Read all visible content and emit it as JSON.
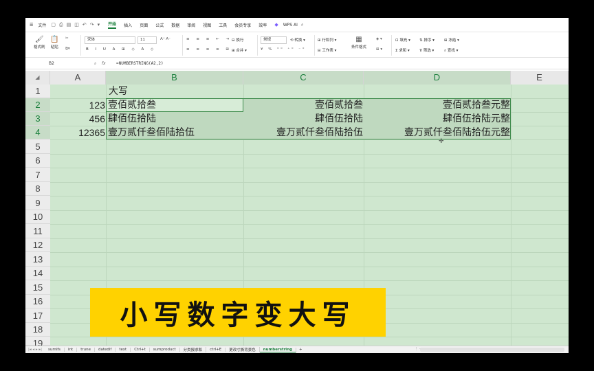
{
  "menubar": {
    "file": "文件",
    "tabs": [
      "开始",
      "插入",
      "页面",
      "公式",
      "数据",
      "审阅",
      "视图",
      "工具",
      "会员专享",
      "效率"
    ],
    "active_tab": "开始",
    "ai": "WPS AI"
  },
  "ribbon": {
    "format_painter": "格式刷",
    "paste": "粘贴",
    "font_name": "宋体",
    "font_size": "11",
    "wrap": "换行",
    "merge": "合并",
    "number_format": "常规",
    "convert": "转换",
    "rows_cols": "行和列",
    "worksheet": "工作表",
    "cond_format": "条件格式",
    "fill": "填充",
    "sort": "排序",
    "freeze": "冻结",
    "sum": "求和",
    "filter": "筛选",
    "find": "查找"
  },
  "formula_bar": {
    "name_box": "B2",
    "formula": "=NUMBERSTRING(A2,2)"
  },
  "columns": [
    "A",
    "B",
    "C",
    "D",
    "E"
  ],
  "rows": [
    "1",
    "2",
    "3",
    "4",
    "5",
    "6",
    "7",
    "8",
    "9",
    "10",
    "11",
    "12",
    "13",
    "14",
    "15",
    "16",
    "17",
    "18",
    "19"
  ],
  "cells": {
    "B1": "大写",
    "A2": "123",
    "B2": "壹佰贰拾叁",
    "C2": "壹佰贰拾叁",
    "D2": "壹佰贰拾叁元整",
    "A3": "456",
    "B3": "肆佰伍拾陆",
    "C3": "肆佰伍拾陆",
    "D3": "肆佰伍拾陆元整",
    "A4": "12365",
    "B4": "壹万贰仟叁佰陆拾伍",
    "C4": "壹万贰仟叁佰陆拾伍",
    "D4": "壹万贰仟叁佰陆拾伍元整"
  },
  "banner": {
    "text": "小写数字变大写"
  },
  "sheet_tabs": [
    "sumifs",
    "int",
    "trune",
    "datedif",
    "text",
    "Ctrl+t",
    "sumproduct",
    "分类报求和",
    "ctrl+E",
    "更改寸撕背景色",
    "numberstring"
  ],
  "active_sheet": "numberstring"
}
